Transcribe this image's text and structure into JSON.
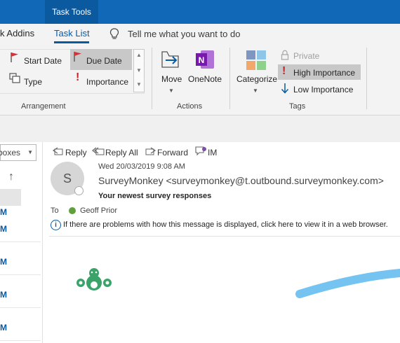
{
  "titlebar": {
    "context_tab": "Task Tools"
  },
  "tabs": {
    "addins": "k Addins",
    "task_list": "Task List",
    "tell_me": "Tell me what you want to do"
  },
  "ribbon": {
    "arrangement": {
      "start_date": "Start Date",
      "due_date": "Due Date",
      "type": "Type",
      "importance": "Importance",
      "group_label": "Arrangement"
    },
    "actions": {
      "move": "Move",
      "onenote": "OneNote",
      "group_label": "Actions"
    },
    "tags": {
      "categorize": "Categorize",
      "private": "Private",
      "high_importance": "High Importance",
      "low_importance": "Low Importance",
      "group_label": "Tags"
    }
  },
  "left_panel": {
    "mailbox_select": "boxes",
    "items": [
      "M",
      "M",
      "M",
      "M",
      "M"
    ]
  },
  "message": {
    "actions": {
      "reply": "Reply",
      "reply_all": "Reply All",
      "forward": "Forward",
      "im": "IM"
    },
    "avatar_initial": "S",
    "date": "Wed 20/03/2019 9:08 AM",
    "sender": "SurveyMonkey <surveymonkey@t.outbound.surveymonkey.com>",
    "subject": "Your newest survey responses",
    "to_label": "To",
    "to_name": "Geoff Prior",
    "info_bar": "If there are problems with how this message is displayed, click here to view it in a web browser."
  },
  "colors": {
    "titlebar": "#1068b7",
    "accent": "#0b5aa0",
    "brand_green": "#3aa36a",
    "swoosh": "#74c3f1",
    "high_importance": "#c4262e"
  }
}
